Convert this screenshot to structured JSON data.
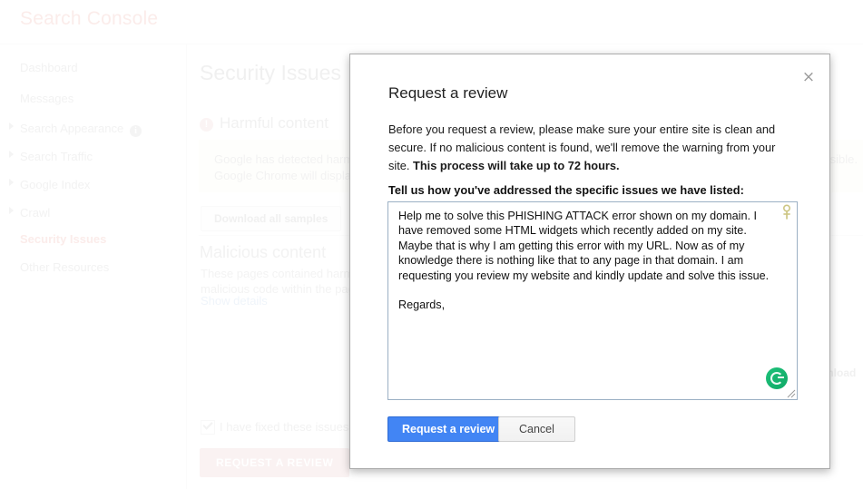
{
  "background": {
    "app_title": "Search Console",
    "sidebar": {
      "items": [
        {
          "label": "Dashboard",
          "expandable": false,
          "selected": false
        },
        {
          "label": "Messages",
          "expandable": false,
          "selected": false
        },
        {
          "label": "Search Appearance",
          "expandable": true,
          "selected": false,
          "badge": "i"
        },
        {
          "label": "Search Traffic",
          "expandable": true,
          "selected": false
        },
        {
          "label": "Google Index",
          "expandable": true,
          "selected": false
        },
        {
          "label": "Crawl",
          "expandable": true,
          "selected": false
        },
        {
          "label": "Security Issues",
          "expandable": false,
          "selected": true
        },
        {
          "label": "Other Resources",
          "expandable": false,
          "selected": false
        }
      ]
    },
    "main": {
      "page_title": "Security Issues",
      "issue_heading": "Harmful content",
      "issue_badge": "!",
      "warning_line1": "Google has detected harmful content on some of your site's pages. We recommend that you remove it as soon as possible.",
      "warning_line2": "Google Chrome will display a warning when users visit your site.",
      "download_all_samples": "Download all samples",
      "section_title": "Malicious content",
      "section_line1": "These pages contained harmful content. Google has detected that some of these pages contain",
      "section_line2": "malicious code within the page or in an embedded resource.",
      "show_details": "Show details",
      "download_label": "Download",
      "checkbox_label": "I have fixed these issues",
      "request_review_button": "REQUEST A REVIEW"
    }
  },
  "modal": {
    "title": "Request a review",
    "close_label": "×",
    "body_part1": "Before you request a review, please make sure your entire site is clean and secure. If no malicious content is found, we'll remove the warning from your site. ",
    "body_bold": "This process will take up to 72 hours.",
    "textarea_label": "Tell us how you've addressed the specific issues we have listed:",
    "textarea_value": "Help me to solve this PHISHING ATTACK error shown on my domain. I have removed some HTML widgets which recently added on my site. Maybe that is why I am getting this error with my URL. Now as of my knowledge there is nothing like that to any page in that domain. I am requesting you review my website and kindly update and solve this issue.\n\nRegards,",
    "grammarly_icon": "grammarly-icon",
    "pin_icon": "pin-icon",
    "resize_icon": "resize-handle-icon",
    "primary_button": "Request a review",
    "cancel_button": "Cancel"
  },
  "colors": {
    "brand_red": "#dd4b39",
    "primary_blue": "#4285f4",
    "warning_bg": "#fcf8e3",
    "grammarly_green": "#15c26b"
  }
}
